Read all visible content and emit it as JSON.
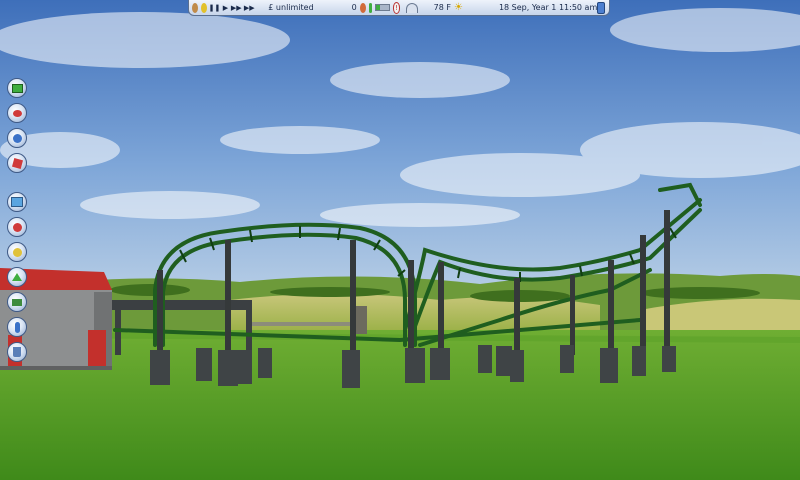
{
  "status_bar": {
    "money": "£ unlimited",
    "guest_count": "0",
    "temperature": "78 F",
    "date_time": "18 Sep, Year 1  11:50 am",
    "park_rating_fraction": 0.35,
    "icons": [
      "park-icon",
      "clock-icon",
      "pause-icon",
      "play-icon",
      "fast-forward-icon",
      "faster-forward-icon",
      "guests-icon",
      "rating-icon",
      "warning-icon",
      "sun-icon",
      "options-icon"
    ]
  },
  "toolbar": {
    "icons": [
      "park-management-icon",
      "finance-icon",
      "guests-icon",
      "research-icon",
      "ride-build-icon",
      "scenery-icon",
      "paths-icon",
      "terrain-icon",
      "water-icon",
      "staff-icon",
      "delete-icon"
    ],
    "accent": "#3f5a86"
  },
  "scene": {
    "description_colors": {
      "sky": "#5b86c8",
      "grass": "#4f9a24",
      "track": "#1f5e1f",
      "support": "#35393a"
    }
  }
}
